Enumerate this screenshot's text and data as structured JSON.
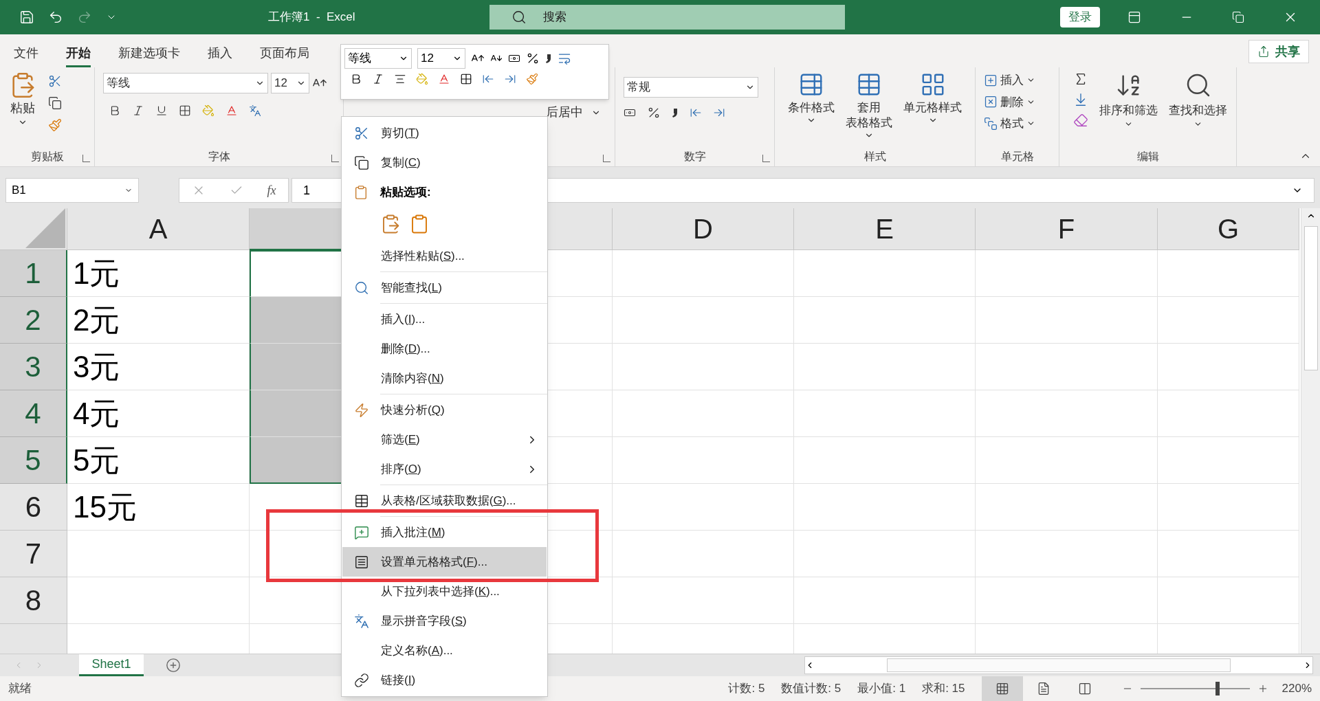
{
  "title_bar": {
    "title": "工作簿1  -  Excel",
    "search_placeholder": "搜索",
    "sign_in": "登录"
  },
  "ribbon_tabs": [
    {
      "label": "文件",
      "selected": false
    },
    {
      "label": "开始",
      "selected": true
    },
    {
      "label": "新建选项卡",
      "selected": false
    },
    {
      "label": "插入",
      "selected": false
    },
    {
      "label": "页面布局",
      "selected": false
    }
  ],
  "share": "共享",
  "clipboard": {
    "label": "剪贴板",
    "paste": "粘贴"
  },
  "font": {
    "label": "字体",
    "font_name": "等线",
    "font_size": "12"
  },
  "alignment": {
    "merge": "后居中"
  },
  "number": {
    "label": "数字",
    "format": "常规"
  },
  "styles": {
    "label": "样式",
    "buttons": [
      [
        "条件格式"
      ],
      [
        "套用",
        "表格格式"
      ],
      [
        "单元格样式"
      ]
    ]
  },
  "cells": {
    "label": "单元格",
    "buttons": [
      "插入",
      "删除",
      "格式"
    ]
  },
  "editing": {
    "label": "编辑",
    "buttons": [
      "排序和筛选",
      "查找和选择"
    ]
  },
  "formula_bar": {
    "name_box": "B1",
    "function": "fx",
    "value": "1"
  },
  "columns": [
    {
      "label": "A",
      "selected": false
    },
    {
      "selected": true
    },
    {
      "selected": false
    },
    {
      "label": "D",
      "selected": false
    },
    {
      "label": "E",
      "selected": false
    },
    {
      "label": "F",
      "selected": false
    },
    {
      "label": "G",
      "selected": false
    }
  ],
  "rows": [
    {
      "header": "1",
      "selected": true,
      "a": "1元"
    },
    {
      "header": "2",
      "selected": true,
      "a": "2元"
    },
    {
      "header": "3",
      "selected": true,
      "a": "3元"
    },
    {
      "header": "4",
      "selected": true,
      "a": "4元"
    },
    {
      "header": "5",
      "selected": true,
      "a": "5元"
    },
    {
      "header": "6",
      "selected": false,
      "a": "15元"
    },
    {
      "header": "7",
      "selected": false
    },
    {
      "header": "8",
      "selected": false
    },
    {
      "selected": false
    }
  ],
  "mini_toolbar": {
    "font_name": "等线",
    "font_size": "12"
  },
  "context_menu": {
    "items": [
      {
        "kind": "item",
        "before": "剪切(",
        "key": "T",
        "after": ")",
        "selected": false,
        "submenu": false
      },
      {
        "kind": "item",
        "before": "复制(",
        "key": "C",
        "after": ")",
        "selected": false,
        "submenu": false
      },
      {
        "kind": "header",
        "text": "粘贴选项:"
      },
      {
        "kind": "paste_options"
      },
      {
        "kind": "item",
        "before": "选择性粘贴(",
        "key": "S",
        "after": ")...",
        "selected": false,
        "submenu": false
      },
      {
        "kind": "separator"
      },
      {
        "kind": "item",
        "before": "智能查找(",
        "key": "L",
        "after": ")",
        "selected": false,
        "submenu": false
      },
      {
        "kind": "separator"
      },
      {
        "kind": "item",
        "before": "插入(",
        "key": "I",
        "after": ")...",
        "selected": false,
        "submenu": false
      },
      {
        "kind": "item",
        "before": "删除(",
        "key": "D",
        "after": ")...",
        "selected": false,
        "submenu": false
      },
      {
        "kind": "item",
        "before": "清除内容(",
        "key": "N",
        "after": ")",
        "selected": false,
        "submenu": false
      },
      {
        "kind": "separator"
      },
      {
        "kind": "item",
        "before": "快速分析(",
        "key": "Q",
        "after": ")",
        "selected": false,
        "submenu": false
      },
      {
        "kind": "item",
        "before": "筛选(",
        "key": "E",
        "after": ")",
        "selected": false,
        "submenu": true
      },
      {
        "kind": "item",
        "before": "排序(",
        "key": "O",
        "after": ")",
        "selected": false,
        "submenu": true
      },
      {
        "kind": "separator"
      },
      {
        "kind": "item",
        "before": "从表格/区域获取数据(",
        "key": "G",
        "after": ")...",
        "selected": false,
        "submenu": false
      },
      {
        "kind": "separator"
      },
      {
        "kind": "item",
        "before": "插入批注(",
        "key": "M",
        "after": ")",
        "selected": false,
        "submenu": false
      },
      {
        "kind": "item",
        "before": "设置单元格格式(",
        "key": "F",
        "after": ")...",
        "selected": true,
        "submenu": false
      },
      {
        "kind": "item",
        "before": "从下拉列表中选择(",
        "key": "K",
        "after": ")...",
        "selected": false,
        "submenu": false
      },
      {
        "kind": "item",
        "before": "显示拼音字段(",
        "key": "S",
        "after": ")",
        "selected": false,
        "submenu": false
      },
      {
        "kind": "item",
        "before": "定义名称(",
        "key": "A",
        "after": ")...",
        "selected": false,
        "submenu": false
      },
      {
        "kind": "item",
        "before": "链接(",
        "key": "I",
        "after": ")",
        "selected": false,
        "submenu": false
      }
    ]
  },
  "sheet_tabs": [
    {
      "label": "Sheet1",
      "selected": true
    }
  ],
  "status_bar": {
    "ready": "就绪",
    "stats": [
      "计数: 5",
      "数值计数: 5",
      "最小值: 1",
      "求和: 15"
    ],
    "views": [
      {
        "kind": "normal",
        "selected": true
      },
      {
        "kind": "page_layout",
        "selected": false
      },
      {
        "kind": "page_break",
        "selected": false
      }
    ],
    "zoom": {
      "level": 0.71,
      "reading": "220%"
    }
  }
}
